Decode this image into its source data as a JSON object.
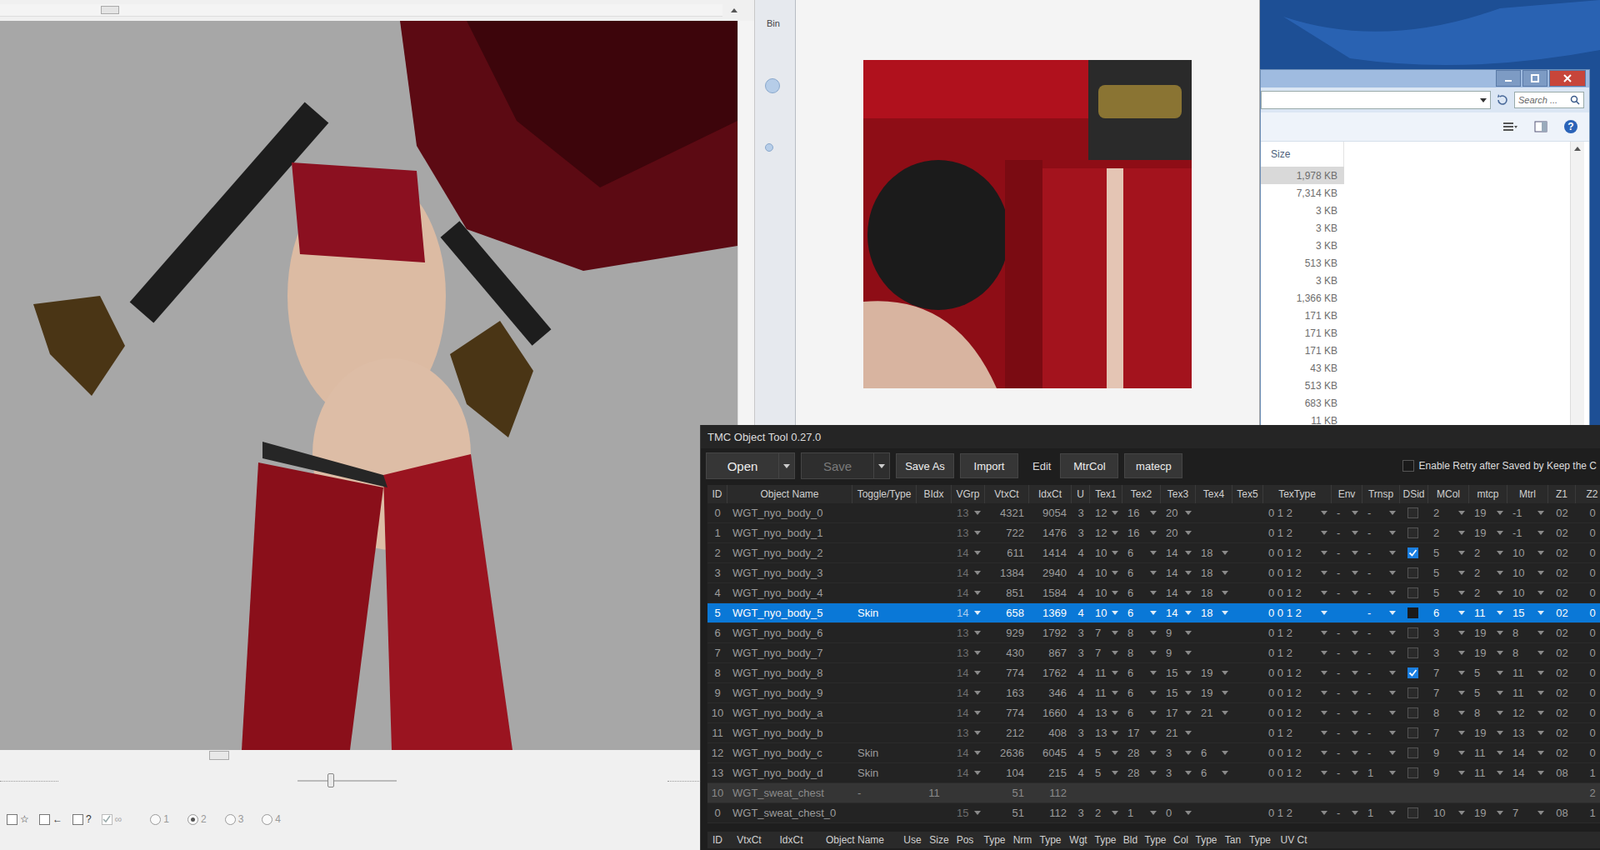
{
  "viewer": {
    "hscroll": {
      "level": 0.14
    },
    "zoom": {
      "level": 0.3
    },
    "toggles": [
      {
        "label": "☆",
        "checked": false,
        "disabled": false
      },
      {
        "label": "←",
        "checked": false,
        "disabled": false
      },
      {
        "label": "?",
        "checked": false,
        "disabled": false
      },
      {
        "label": "∞",
        "checked": true,
        "disabled": true
      }
    ],
    "views": [
      {
        "label": "1",
        "selected": false
      },
      {
        "label": "2",
        "selected": true
      },
      {
        "label": "3",
        "selected": false
      },
      {
        "label": "4",
        "selected": false
      }
    ]
  },
  "side_window": {
    "title": "Bin"
  },
  "explorer": {
    "search": {
      "placeholder": "Search ..."
    },
    "help": "?",
    "column": "Size",
    "files": [
      {
        "size": "1,978 KB",
        "selected": true
      },
      {
        "size": "7,314 KB",
        "selected": false
      },
      {
        "size": "3 KB",
        "selected": false
      },
      {
        "size": "3 KB",
        "selected": false
      },
      {
        "size": "3 KB",
        "selected": false
      },
      {
        "size": "513 KB",
        "selected": false
      },
      {
        "size": "3 KB",
        "selected": false
      },
      {
        "size": "1,366 KB",
        "selected": false
      },
      {
        "size": "171 KB",
        "selected": false
      },
      {
        "size": "171 KB",
        "selected": false
      },
      {
        "size": "171 KB",
        "selected": false
      },
      {
        "size": "43 KB",
        "selected": false
      },
      {
        "size": "513 KB",
        "selected": false
      },
      {
        "size": "683 KB",
        "selected": false
      },
      {
        "size": "11 KB",
        "selected": false
      }
    ]
  },
  "tmc": {
    "title": "TMC Object Tool 0.27.0",
    "toolbar": [
      {
        "label": "Open",
        "kind": "split",
        "disabled": false
      },
      {
        "label": "Save",
        "kind": "split",
        "disabled": true
      },
      {
        "label": "Save As",
        "kind": "button",
        "disabled": false
      },
      {
        "label": "Import",
        "kind": "button",
        "disabled": false
      },
      {
        "label": "Edit",
        "kind": "label",
        "disabled": false
      },
      {
        "label": "MtrCol",
        "kind": "button",
        "disabled": false
      },
      {
        "label": "matecp",
        "kind": "button",
        "disabled": false
      }
    ],
    "retry": {
      "label": "Enable Retry after Saved by Keep the C",
      "checked": false
    },
    "columns": [
      {
        "label": "ID",
        "kind": "text"
      },
      {
        "label": "Object Name",
        "kind": "name"
      },
      {
        "label": "Toggle/Type",
        "kind": "name"
      },
      {
        "label": "BIdx",
        "kind": "text"
      },
      {
        "label": "VGrp",
        "kind": "dropdown"
      },
      {
        "label": "VtxCt",
        "kind": "number"
      },
      {
        "label": "IdxCt",
        "kind": "number"
      },
      {
        "label": "U",
        "kind": "text"
      },
      {
        "label": "Tex1",
        "kind": "dropdown"
      },
      {
        "label": "Tex2",
        "kind": "dropdown"
      },
      {
        "label": "Tex3",
        "kind": "dropdown"
      },
      {
        "label": "Tex4",
        "kind": "dropdown"
      },
      {
        "label": "Tex5",
        "kind": "text"
      },
      {
        "label": "TexType",
        "kind": "dropdown"
      },
      {
        "label": "Env",
        "kind": "dropdown"
      },
      {
        "label": "Trnsp",
        "kind": "dropdown"
      },
      {
        "label": "DSid",
        "kind": "check"
      },
      {
        "label": "MCol",
        "kind": "dropdown"
      },
      {
        "label": "mtcp",
        "kind": "dropdown"
      },
      {
        "label": "Mtrl",
        "kind": "dropdown"
      },
      {
        "label": "Z1",
        "kind": "text"
      },
      {
        "label": "Z2",
        "kind": "text"
      }
    ],
    "rows": [
      {
        "kind": "object",
        "selected": false,
        "dsid": false,
        "cells": [
          "0",
          "WGT_nyo_body_0",
          "",
          "",
          "13",
          "4321",
          "9054",
          "3",
          "12",
          "16",
          "20",
          "",
          "",
          "0 1 2",
          "-",
          "-",
          "",
          "2",
          "19",
          "-1",
          "02",
          "0"
        ]
      },
      {
        "kind": "object",
        "selected": false,
        "dsid": false,
        "cells": [
          "1",
          "WGT_nyo_body_1",
          "",
          "",
          "13",
          "722",
          "1476",
          "3",
          "12",
          "16",
          "20",
          "",
          "",
          "0 1 2",
          "-",
          "-",
          "",
          "2",
          "19",
          "-1",
          "02",
          "0"
        ]
      },
      {
        "kind": "object",
        "selected": false,
        "dsid": true,
        "cells": [
          "2",
          "WGT_nyo_body_2",
          "",
          "",
          "14",
          "611",
          "1414",
          "4",
          "10",
          "6",
          "14",
          "18",
          "",
          "0 0 1 2",
          "-",
          "-",
          "",
          "5",
          "2",
          "10",
          "02",
          "0"
        ]
      },
      {
        "kind": "object",
        "selected": false,
        "dsid": false,
        "cells": [
          "3",
          "WGT_nyo_body_3",
          "",
          "",
          "14",
          "1384",
          "2940",
          "4",
          "10",
          "6",
          "14",
          "18",
          "",
          "0 0 1 2",
          "-",
          "-",
          "",
          "5",
          "2",
          "10",
          "02",
          "0"
        ]
      },
      {
        "kind": "object",
        "selected": false,
        "dsid": false,
        "cells": [
          "4",
          "WGT_nyo_body_4",
          "",
          "",
          "14",
          "851",
          "1584",
          "4",
          "10",
          "6",
          "14",
          "18",
          "",
          "0 0 1 2",
          "-",
          "-",
          "",
          "5",
          "2",
          "10",
          "02",
          "0"
        ]
      },
      {
        "kind": "object",
        "selected": true,
        "dsid": false,
        "cells": [
          "5",
          "WGT_nyo_body_5",
          "Skin",
          "",
          "14",
          "658",
          "1369",
          "4",
          "10",
          "6",
          "14",
          "18",
          "",
          "0 0 1 2",
          "",
          "-",
          "",
          "6",
          "11",
          "15",
          "02",
          "0"
        ]
      },
      {
        "kind": "object",
        "selected": false,
        "dsid": false,
        "cells": [
          "6",
          "WGT_nyo_body_6",
          "",
          "",
          "13",
          "929",
          "1792",
          "3",
          "7",
          "8",
          "9",
          "",
          "",
          "0 1 2",
          "-",
          "-",
          "",
          "3",
          "19",
          "8",
          "02",
          "0"
        ]
      },
      {
        "kind": "object",
        "selected": false,
        "dsid": false,
        "cells": [
          "7",
          "WGT_nyo_body_7",
          "",
          "",
          "13",
          "430",
          "867",
          "3",
          "7",
          "8",
          "9",
          "",
          "",
          "0 1 2",
          "-",
          "-",
          "",
          "3",
          "19",
          "8",
          "02",
          "0"
        ]
      },
      {
        "kind": "object",
        "selected": false,
        "dsid": true,
        "cells": [
          "8",
          "WGT_nyo_body_8",
          "",
          "",
          "14",
          "774",
          "1762",
          "4",
          "11",
          "6",
          "15",
          "19",
          "",
          "0 0 1 2",
          "-",
          "-",
          "",
          "7",
          "5",
          "11",
          "02",
          "0"
        ]
      },
      {
        "kind": "object",
        "selected": false,
        "dsid": false,
        "cells": [
          "9",
          "WGT_nyo_body_9",
          "",
          "",
          "14",
          "163",
          "346",
          "4",
          "11",
          "6",
          "15",
          "19",
          "",
          "0 0 1 2",
          "-",
          "-",
          "",
          "7",
          "5",
          "11",
          "02",
          "0"
        ]
      },
      {
        "kind": "object",
        "selected": false,
        "dsid": false,
        "cells": [
          "10",
          "WGT_nyo_body_a",
          "",
          "",
          "14",
          "774",
          "1660",
          "4",
          "13",
          "6",
          "17",
          "21",
          "",
          "0 0 1 2",
          "-",
          "-",
          "",
          "8",
          "8",
          "12",
          "02",
          "0"
        ]
      },
      {
        "kind": "object",
        "selected": false,
        "dsid": false,
        "cells": [
          "11",
          "WGT_nyo_body_b",
          "",
          "",
          "13",
          "212",
          "408",
          "3",
          "13",
          "17",
          "21",
          "",
          "",
          "0 1 2",
          "-",
          "-",
          "",
          "7",
          "19",
          "13",
          "02",
          "0"
        ]
      },
      {
        "kind": "object",
        "selected": false,
        "dsid": false,
        "cells": [
          "12",
          "WGT_nyo_body_c",
          "Skin",
          "",
          "14",
          "2636",
          "6045",
          "4",
          "5",
          "28",
          "3",
          "6",
          "",
          "0 0 1 2",
          "-",
          "-",
          "",
          "9",
          "11",
          "14",
          "02",
          "0"
        ]
      },
      {
        "kind": "object",
        "selected": false,
        "dsid": false,
        "cells": [
          "13",
          "WGT_nyo_body_d",
          "Skin",
          "",
          "14",
          "104",
          "215",
          "4",
          "5",
          "28",
          "3",
          "6",
          "",
          "0 0 1 2",
          "-",
          "1",
          "",
          "9",
          "11",
          "14",
          "08",
          "1"
        ]
      },
      {
        "kind": "group",
        "selected": false,
        "cells": [
          "10",
          "WGT_sweat_chest",
          "-",
          "11",
          "",
          "51",
          "112",
          "",
          "",
          "",
          "",
          "",
          "",
          "",
          "",
          "",
          "",
          "",
          "",
          "",
          "",
          "2"
        ]
      },
      {
        "kind": "object",
        "selected": false,
        "dsid": false,
        "cells": [
          "0",
          "WGT_sweat_chest_0",
          "",
          "",
          "15",
          "51",
          "112",
          "3",
          "2",
          "1",
          "0",
          "",
          "",
          "0 1 2",
          "-",
          "1",
          "",
          "10",
          "19",
          "7",
          "08",
          "1"
        ]
      }
    ],
    "sub_columns": [
      "ID",
      "VtxCt",
      "IdxCt",
      "Object Name",
      "Use",
      "Size",
      "Pos",
      "Type",
      "Nrm",
      "Type",
      "Wgt",
      "Type",
      "Bld",
      "Type",
      "Col",
      "Type",
      "Tan",
      "Type",
      "UV Ct"
    ]
  }
}
